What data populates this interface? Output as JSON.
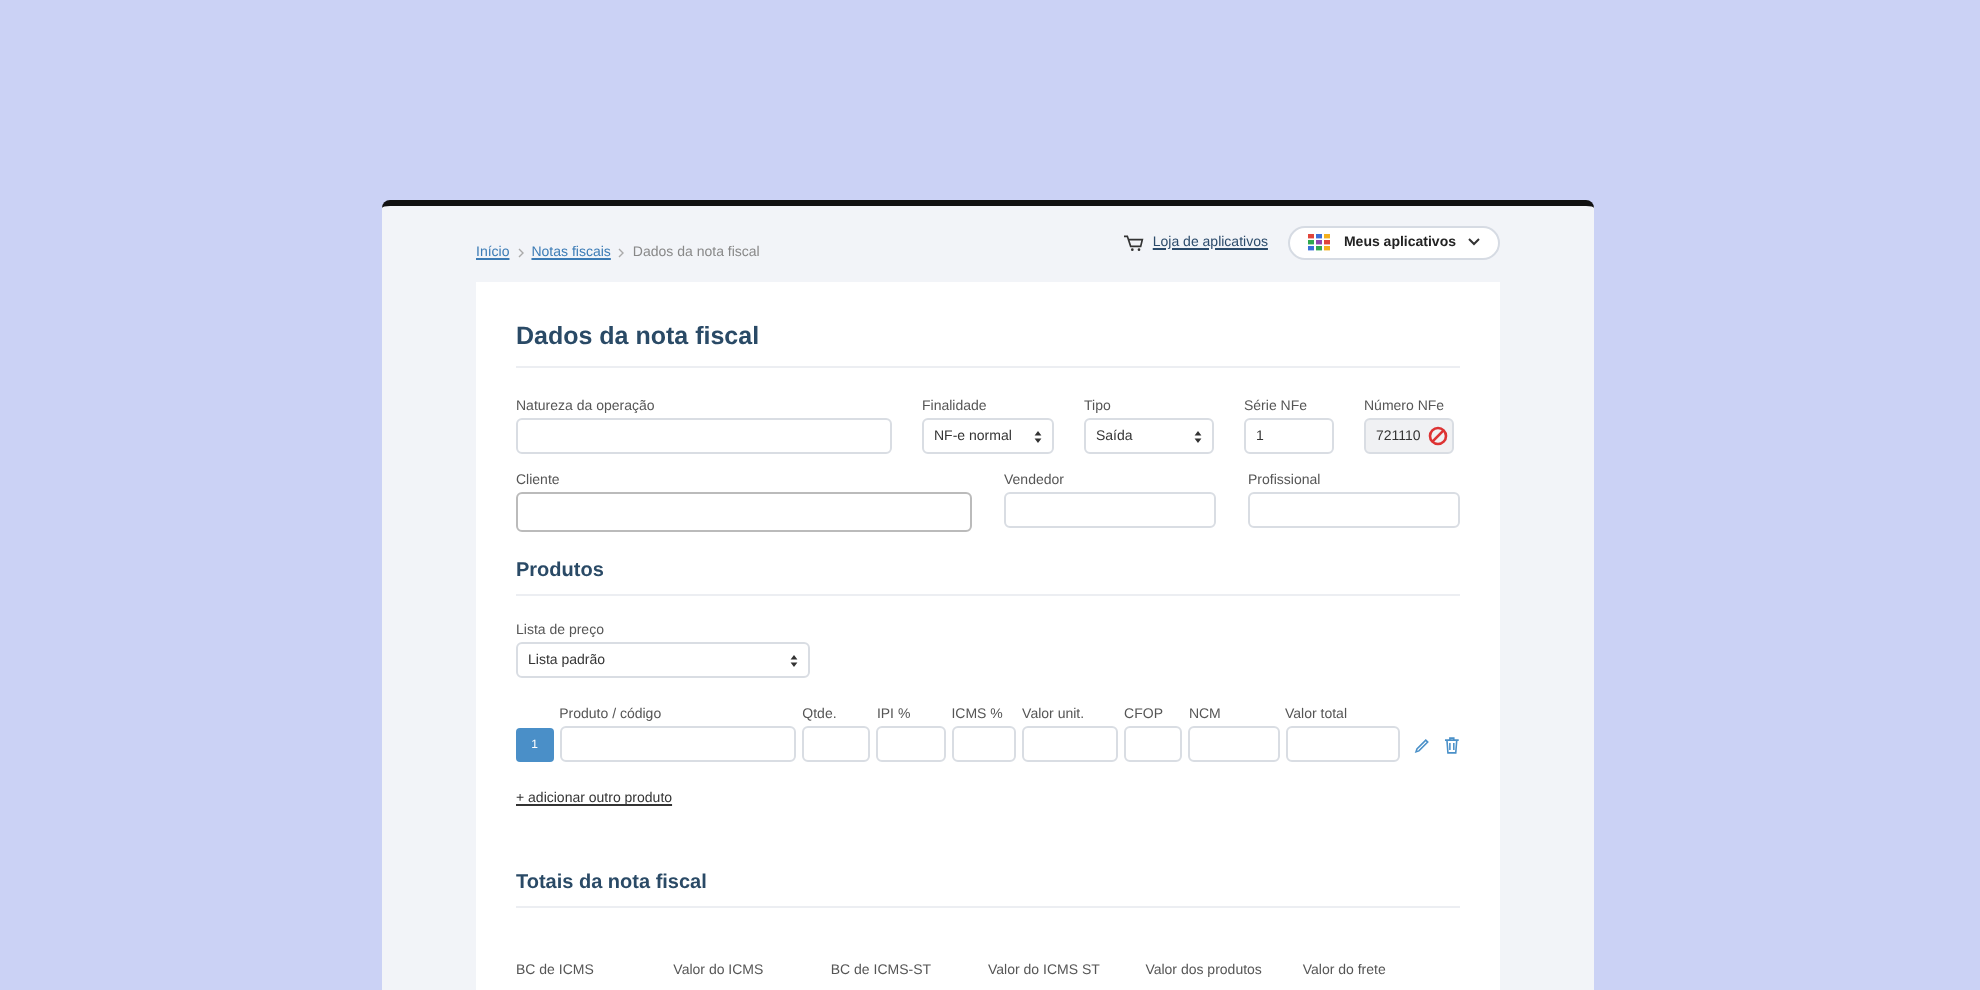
{
  "breadcrumb": [
    {
      "label": "Início",
      "link": true
    },
    {
      "label": "Notas fiscais",
      "link": true
    },
    {
      "label": "Dados da nota fiscal",
      "link": false
    }
  ],
  "store_link": "Loja de aplicativos",
  "apps_button": "Meus aplicativos",
  "title": "Dados da nota fiscal",
  "fields": [
    {
      "label": "Natureza da operação",
      "kind": "text"
    },
    {
      "label": "Finalidade",
      "kind": "select",
      "value": "NF-e normal"
    },
    {
      "label": "Tipo",
      "kind": "select",
      "value": "Saída"
    },
    {
      "label": "Série NFe",
      "kind": "text",
      "value": "1"
    },
    {
      "label": "Número NFe",
      "kind": "disabled",
      "value": "721110"
    }
  ],
  "fields_row2": [
    {
      "label": "Cliente",
      "kind": "text"
    },
    {
      "label": "Vendedor",
      "kind": "text"
    },
    {
      "label": "Profissional",
      "kind": "text"
    }
  ],
  "products_title": "Produtos",
  "price_list": {
    "label": "Lista de preço",
    "value": "Lista padrão"
  },
  "product_row": {
    "number": "1",
    "columns": [
      "Produto / código",
      "Qtde.",
      "IPI %",
      "ICMS %",
      "Valor unit.",
      "CFOP",
      "NCM",
      "Valor total"
    ]
  },
  "add_product": "+ adicionar outro produto",
  "totals_title": "Totais da nota fiscal",
  "totals_columns": [
    "BC de ICMS",
    "Valor do ICMS",
    "BC de ICMS-ST",
    "Valor do ICMS ST",
    "Valor dos produtos",
    "Valor do frete"
  ]
}
